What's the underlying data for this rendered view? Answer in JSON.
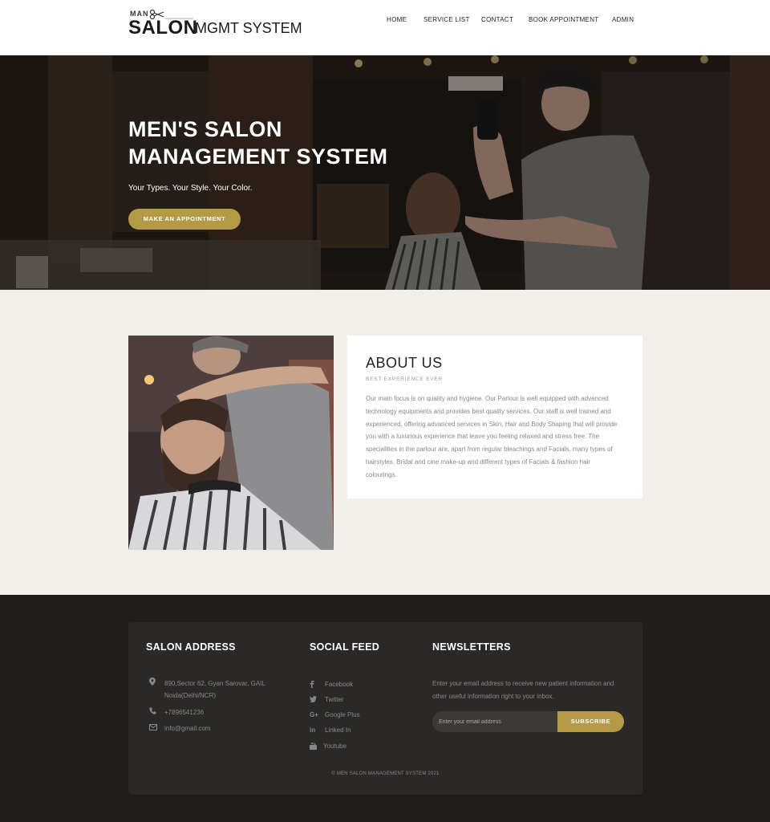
{
  "header": {
    "logo": {
      "small": "MAN",
      "big": "SALON",
      "suffix": "MGMT SYSTEM"
    },
    "nav": [
      {
        "label": "HOME"
      },
      {
        "label": "SERVICE LIST"
      },
      {
        "label": "CONTACT"
      },
      {
        "label": "BOOK APPOINTMENT"
      },
      {
        "label": "ADMIN"
      }
    ]
  },
  "hero": {
    "title_line1": "MEN'S SALON",
    "title_line2": "MANAGEMENT SYSTEM",
    "subtitle": "Your Types. Your Style. Your Color.",
    "button_label": "MAKE AN APPOINTMENT"
  },
  "about": {
    "title": "ABOUT US",
    "subtitle": "BEST EXPERIENCE EVER",
    "text": "Our main focus is on quality and hygiene. Our Parlour is well equipped with advanced technology equipments and provides best quality services. Our staff is well trained and experienced, offering advanced services in Skin, Hair and Body Shaping that will provide you with a luxurious experience that leave you feeling relaxed and stress free. The specialities in the parlour are, apart from regular bleachings and Facials, many types of hairstyles, Bridal and cine make-up and different types of Facials & fashion hair colourings."
  },
  "footer": {
    "address": {
      "heading": "SALON ADDRESS",
      "items": [
        {
          "icon": "map-marker-icon",
          "text": "890,Sector 62, Gyan Sarovar, GAIL Noida(Delhi/NCR)"
        },
        {
          "icon": "phone-icon",
          "text": "+7896541236"
        },
        {
          "icon": "envelope-icon",
          "text": "info@gmail.com"
        }
      ]
    },
    "social": {
      "heading": "SOCIAL FEED",
      "items": [
        {
          "icon": "facebook-icon",
          "label": "Facebook"
        },
        {
          "icon": "twitter-icon",
          "label": "Twitter"
        },
        {
          "icon": "google-plus-icon",
          "label": "Google Plus"
        },
        {
          "icon": "linkedin-icon",
          "label": "Linked In"
        },
        {
          "icon": "youtube-icon",
          "label": "Youtube"
        }
      ]
    },
    "newsletter": {
      "heading": "NEWSLETTERS",
      "text": "Enter your email address to receive new patient information and other useful information right to your inbox.",
      "placeholder": "Enter your email address",
      "button_label": "SUBSCRIBE"
    },
    "copyright": "© MEN SALON MANAGEMENT SYSTEM 2021"
  },
  "colors": {
    "accent": "#b59a45",
    "footer_bg": "#1f1e1c",
    "about_bg": "#f2efea"
  }
}
